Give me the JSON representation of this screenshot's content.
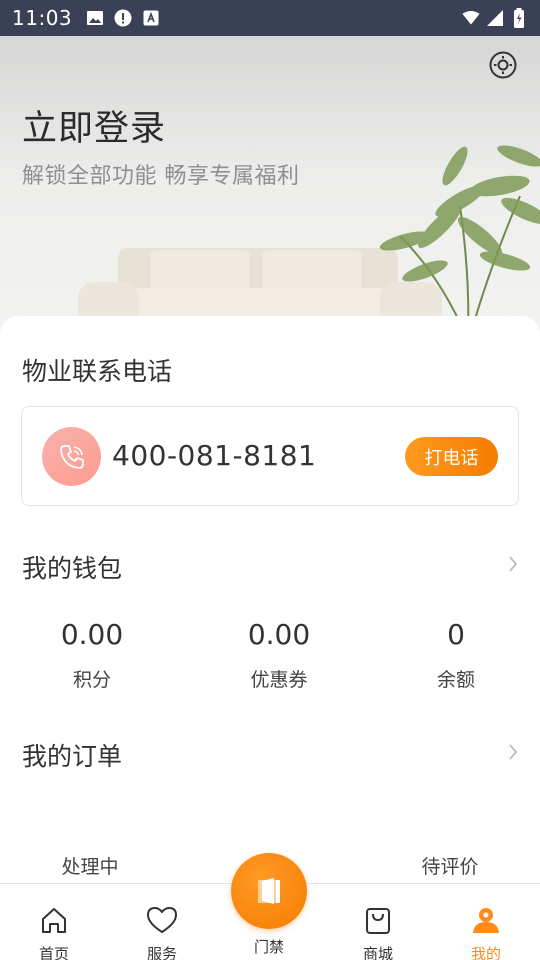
{
  "status_bar": {
    "time": "11:03"
  },
  "hero": {
    "title": "立即登录",
    "subtitle": "解锁全部功能 畅享专属福利"
  },
  "property": {
    "title": "物业联系电话",
    "phone": "400-081-8181",
    "call_label": "打电话"
  },
  "wallet": {
    "title": "我的钱包",
    "items": [
      {
        "value": "0.00",
        "label": "积分"
      },
      {
        "value": "0.00",
        "label": "优惠券"
      },
      {
        "value": "0",
        "label": "余额"
      }
    ]
  },
  "orders": {
    "title": "我的订单",
    "items": [
      "处理中",
      "待评价"
    ]
  },
  "tabbar": {
    "items": [
      {
        "label": "首页",
        "icon": "home-icon"
      },
      {
        "label": "服务",
        "icon": "heart-icon"
      },
      {
        "label": "门禁",
        "icon": "door-icon"
      },
      {
        "label": "商城",
        "icon": "shopping-bag-icon"
      },
      {
        "label": "我的",
        "icon": "user-icon"
      }
    ],
    "active": "我的"
  },
  "colors": {
    "accent": "#ff8c1a",
    "status_bar": "#3a4157",
    "call_gradient_start": "#ff9a1e",
    "call_gradient_end": "#f57c00",
    "phone_avatar": "#ffa39a"
  }
}
